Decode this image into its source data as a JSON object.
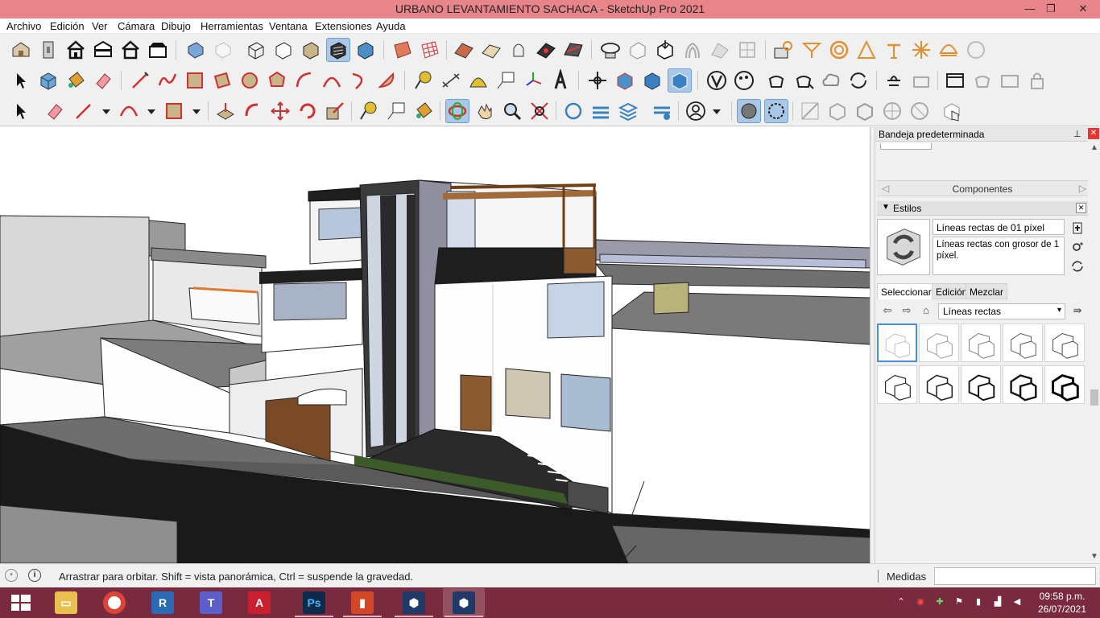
{
  "window": {
    "title": "URBANO LEVANTAMIENTO SACHACA - SketchUp Pro 2021",
    "minimize": "—",
    "restore": "❐",
    "close": "✕"
  },
  "menu": [
    "Archivo",
    "Edición",
    "Ver",
    "Cámara",
    "Dibujo",
    "Herramientas",
    "Ventana",
    "Extensiones",
    "Ayuda"
  ],
  "tray": {
    "title": "Bandeja predeterminada",
    "pin": "📌",
    "close": "✕",
    "components_label": "Componentes",
    "styles": {
      "header": "Estilos",
      "name": "Líneas rectas de 01 píxel",
      "description": "Líneas rectas con grosor de 1 píxel.",
      "tabs": [
        "Seleccionar",
        "Edición",
        "Mezclar"
      ],
      "active_tab": "Seleccionar",
      "collection": "Líneas rectas"
    }
  },
  "status": {
    "message": "Arrastrar para orbitar. Shift = vista panorámica, Ctrl = suspende la gravedad.",
    "measurements_label": "Medidas",
    "measurements_value": ""
  },
  "taskbar": {
    "time": "09:58 p.m.",
    "date": "26/07/2021",
    "apps": [
      "windows-start",
      "file-explorer",
      "chrome",
      "revit",
      "teams",
      "autocad",
      "photoshop",
      "office",
      "sketchup",
      "sketchup-active"
    ]
  },
  "colors": {
    "titlebar": "#e8858b",
    "taskbar": "#7a2a3f",
    "active_tool": "#a9c8e8",
    "selected_style": "#4a90d9"
  }
}
